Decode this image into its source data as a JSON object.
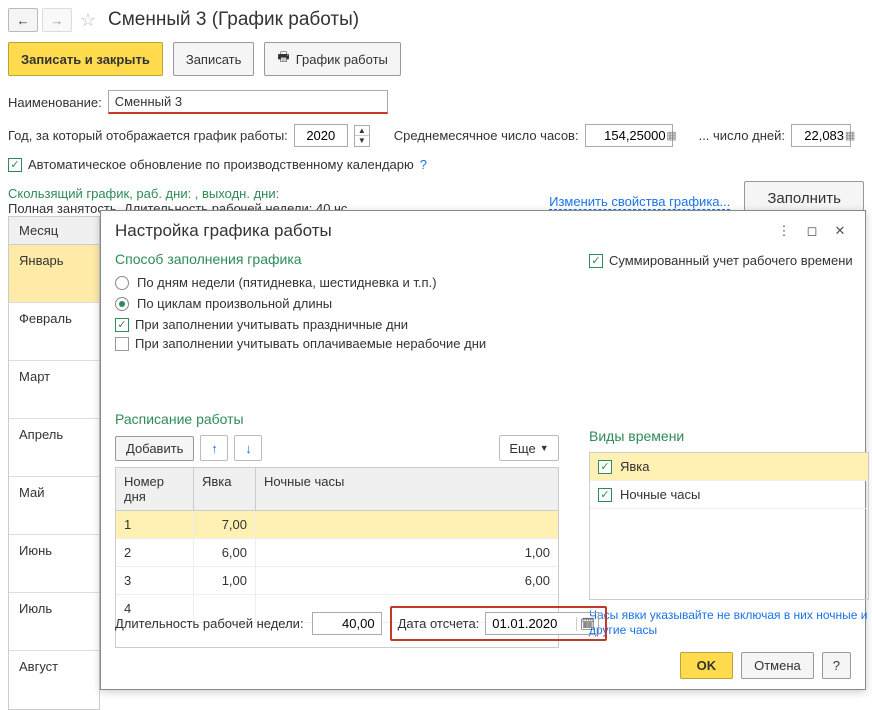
{
  "header": {
    "title": "Сменный 3 (График работы)"
  },
  "toolbar": {
    "save_close": "Записать и закрыть",
    "save": "Записать",
    "print": "График работы"
  },
  "fields": {
    "name_label": "Наименование:",
    "name_value": "Сменный 3",
    "year_label": "Год, за который отображается график работы:",
    "year_value": "2020",
    "avg_hours_label": "Среднемесячное число часов:",
    "avg_hours_value": "154,25000",
    "days_label": "... число дней:",
    "days_value": "22,083",
    "auto_update": "Автоматическое обновление по производственному календарю",
    "help": "?"
  },
  "desc": {
    "line1": "Скользящий график, раб. дни: , выходн. дни:",
    "line2": "Полная занятость. Длительность рабочей недели: 40 чс.",
    "link": "Изменить свойства графика...",
    "fill_btn": "Заполнить"
  },
  "sidebar": {
    "header": "Месяц",
    "months": [
      "Январь",
      "Февраль",
      "Март",
      "Апрель",
      "Май",
      "Июнь",
      "Июль",
      "Август"
    ]
  },
  "modal": {
    "title": "Настройка графика работы",
    "fill_method_title": "Способ заполнения графика",
    "summed_time": "Суммированный учет рабочего времени",
    "by_weekdays": "По дням недели (пятидневка, шестидневка и т.п.)",
    "by_cycles": "По циклам произвольной длины",
    "holidays": "При заполнении учитывать праздничные дни",
    "paid_nonwork": "При заполнении учитывать оплачиваемые нерабочие дни",
    "schedule_title": "Расписание работы",
    "add_btn": "Добавить",
    "more_btn": "Еще",
    "columns": {
      "day": "Номер дня",
      "attend": "Явка",
      "night": "Ночные часы"
    },
    "rows": [
      {
        "day": "1",
        "attend": "7,00",
        "night": ""
      },
      {
        "day": "2",
        "attend": "6,00",
        "night": "1,00"
      },
      {
        "day": "3",
        "attend": "1,00",
        "night": "6,00"
      },
      {
        "day": "4",
        "attend": "",
        "night": ""
      }
    ],
    "types_title": "Виды времени",
    "types": [
      "Явка",
      "Ночные часы"
    ],
    "types_hint": "Часы явки указывайте не включая в них ночные и другие часы",
    "week_duration_label": "Длительность рабочей недели:",
    "week_duration_value": "40,00",
    "start_date_label": "Дата отсчета:",
    "start_date_value": "01.01.2020",
    "ok": "OK",
    "cancel": "Отмена",
    "help": "?"
  }
}
